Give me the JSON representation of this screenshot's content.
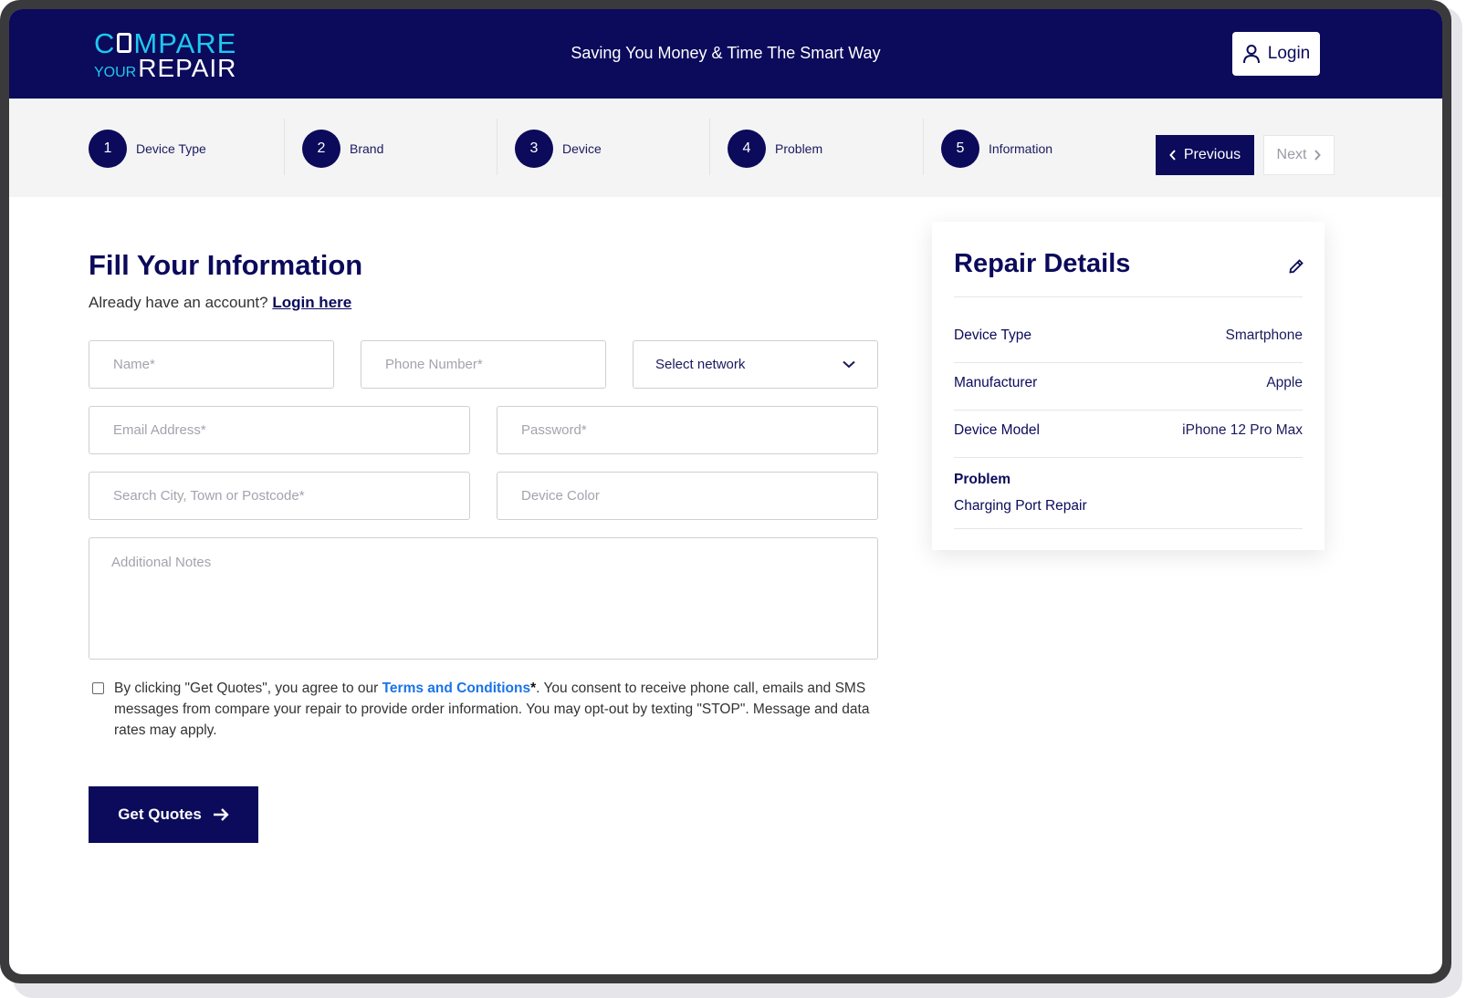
{
  "brand": {
    "logo_line1_prefix": "C",
    "logo_line1_rest": "MPARE",
    "logo_line2_small": "YOUR",
    "logo_line2_large": "REPAIR",
    "tagline": "Saving You Money & Time The Smart Way",
    "login_label": "Login"
  },
  "steps": [
    {
      "num": "1",
      "label": "Device Type"
    },
    {
      "num": "2",
      "label": "Brand"
    },
    {
      "num": "3",
      "label": "Device"
    },
    {
      "num": "4",
      "label": "Problem"
    },
    {
      "num": "5",
      "label": "Information"
    }
  ],
  "nav": {
    "previous": "Previous",
    "next": "Next"
  },
  "form": {
    "title": "Fill Your Information",
    "subtitle": "Already have an account?",
    "login_link": "Login here",
    "name_placeholder": "Name*",
    "phone_placeholder": "Phone Number*",
    "network_select": "Select network",
    "email_placeholder": "Email Address*",
    "password_placeholder": "Password*",
    "city_placeholder": "Search City, Town or Postcode*",
    "color_placeholder": "Device Color",
    "notes_placeholder": "Additional Notes",
    "consent_prefix": "By clicking \"Get Quotes\", you agree to our ",
    "consent_terms": "Terms and Conditions",
    "consent_star": "*",
    "consent_suffix": ". You consent to receive phone call, emails and SMS messages from compare your repair to provide order information. You may opt-out by texting \"STOP\". Message and data rates may apply.",
    "consent_checked": false,
    "submit_label": "Get Quotes"
  },
  "details": {
    "title": "Repair Details",
    "rows": [
      {
        "key": "Device Type",
        "value": "Smartphone"
      },
      {
        "key": "Manufacturer",
        "value": "Apple"
      },
      {
        "key": "Device Model",
        "value": "iPhone 12 Pro Max"
      }
    ],
    "problem_label": "Problem",
    "problem_value": "Charging Port Repair"
  },
  "colors": {
    "primary": "#0b0a5b",
    "accent": "#1ec8ee",
    "link": "#1a73e8"
  },
  "icons": [
    "user-icon",
    "chevron-left-icon",
    "chevron-right-icon",
    "chevron-down-icon",
    "arrow-right-icon",
    "pencil-icon"
  ]
}
